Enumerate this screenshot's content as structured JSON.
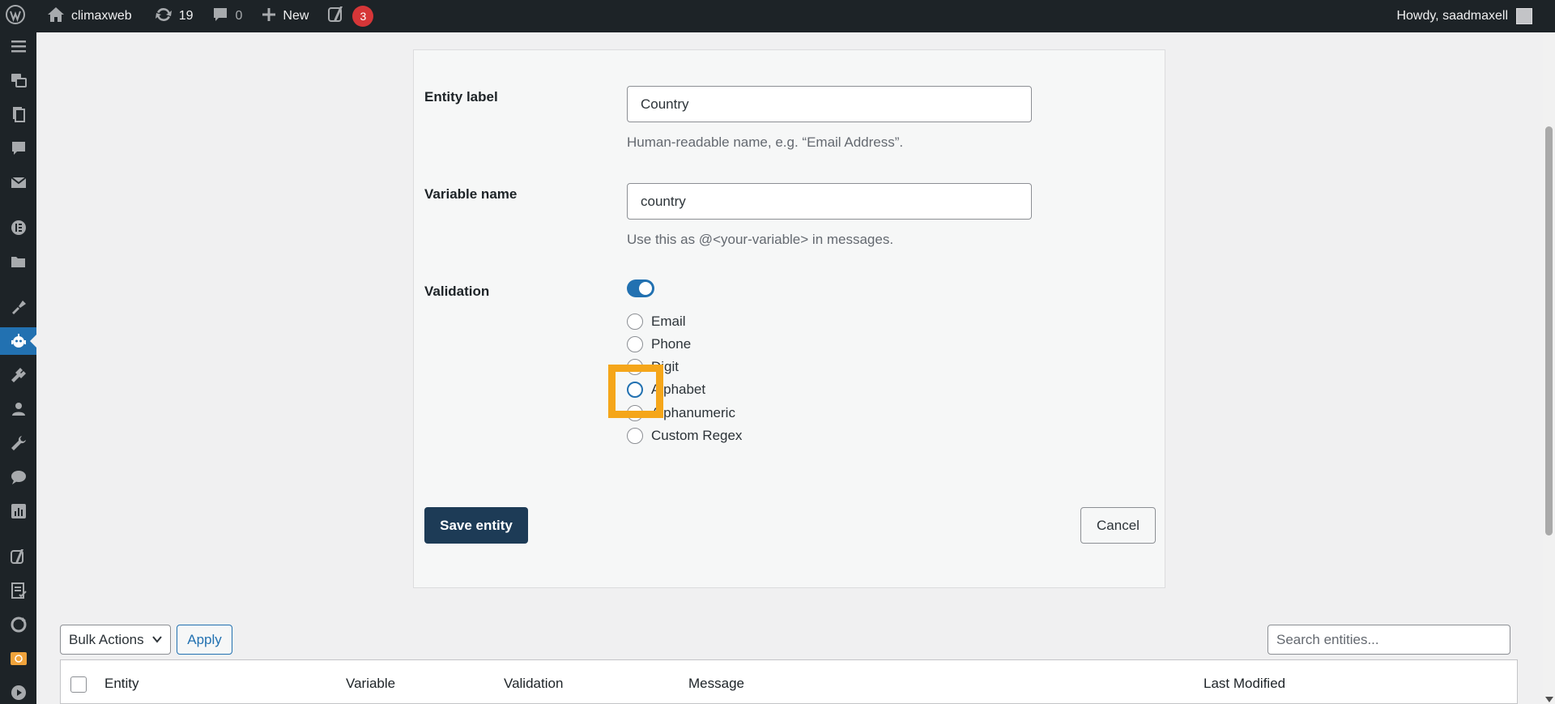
{
  "admin_bar": {
    "site_name": "climaxweb",
    "updates_count": "19",
    "comments_count": "0",
    "new_label": "New",
    "yoast_badge": "3",
    "greeting": "Howdy, saadmaxell"
  },
  "form": {
    "entity_label": {
      "label": "Entity label",
      "value": "Country",
      "help": "Human-readable name, e.g. “Email Address”."
    },
    "variable_name": {
      "label": "Variable name",
      "value": "country",
      "help": "Use this as @<your-variable> in messages."
    },
    "validation": {
      "label": "Validation",
      "enabled": true,
      "options": [
        "Email",
        "Phone",
        "Digit",
        "Alphabet",
        "Alphanumeric",
        "Custom Regex"
      ]
    },
    "save_label": "Save entity",
    "cancel_label": "Cancel"
  },
  "table": {
    "bulk_actions": "Bulk Actions",
    "apply_label": "Apply",
    "search_placeholder": "Search entities...",
    "columns": [
      "Entity",
      "Variable",
      "Validation",
      "Message",
      "Last Modified"
    ]
  },
  "colors": {
    "accent": "#2271b1",
    "primary_button": "#1d3b56",
    "highlight": "#f5a61a",
    "admin_bar": "#1d2327"
  }
}
